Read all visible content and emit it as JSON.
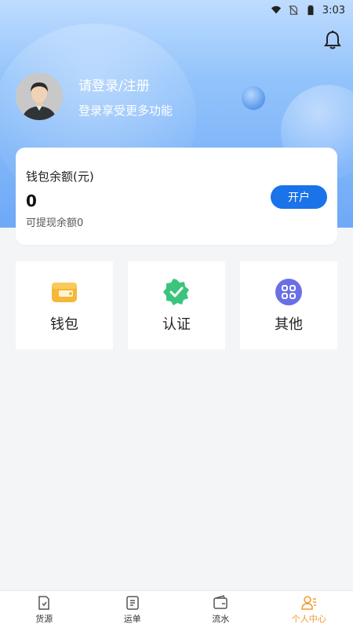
{
  "status_bar": {
    "time": "3:03"
  },
  "profile": {
    "title": "请登录/注册",
    "subtitle": "登录享受更多功能"
  },
  "wallet": {
    "label": "钱包余额(元)",
    "amount": "0",
    "withdrawable": "可提现余额0",
    "open_button": "开户"
  },
  "tiles": [
    {
      "label": "钱包",
      "icon": "wallet-icon",
      "color": "#f6b738"
    },
    {
      "label": "认证",
      "icon": "verified-badge-icon",
      "color": "#3cc47c"
    },
    {
      "label": "其他",
      "icon": "grid-more-icon",
      "color": "#6b6fe6"
    }
  ],
  "bottom_nav": [
    {
      "label": "货源",
      "icon": "goods-icon"
    },
    {
      "label": "运单",
      "icon": "waybill-icon"
    },
    {
      "label": "流水",
      "icon": "wallet-flow-icon"
    },
    {
      "label": "个人中心",
      "icon": "profile-icon",
      "active": true
    }
  ],
  "colors": {
    "accent": "#1a73e8",
    "active_tab": "#f29a2e"
  }
}
